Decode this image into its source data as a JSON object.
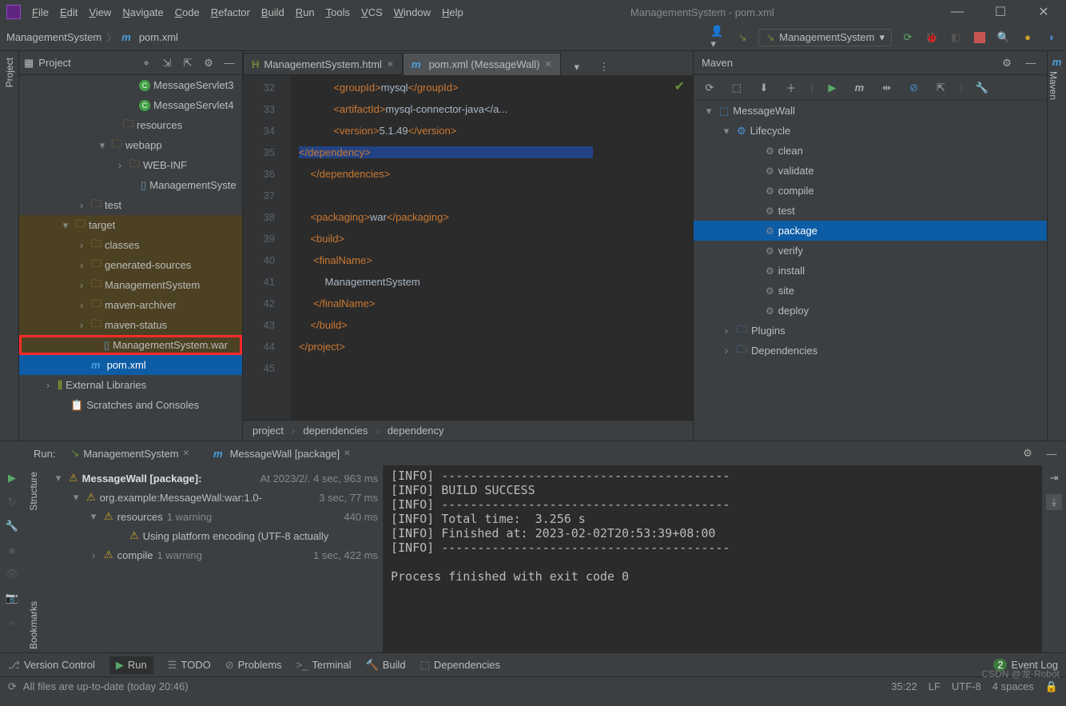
{
  "title": "ManagementSystem - pom.xml",
  "menu": [
    "File",
    "Edit",
    "View",
    "Navigate",
    "Code",
    "Refactor",
    "Build",
    "Run",
    "Tools",
    "VCS",
    "Window",
    "Help"
  ],
  "breadcrumb": {
    "root": "ManagementSystem",
    "file": "pom.xml"
  },
  "config_selected": "ManagementSystem",
  "project_panel": {
    "title": "Project",
    "tree": [
      {
        "indent": 120,
        "chev": "",
        "icon": "class",
        "label": "MessageServlet3"
      },
      {
        "indent": 120,
        "chev": "",
        "icon": "class",
        "label": "MessageServlet4"
      },
      {
        "indent": 100,
        "chev": "",
        "icon": "folder",
        "label": "resources"
      },
      {
        "indent": 86,
        "chev": "▾",
        "icon": "folder",
        "label": "webapp"
      },
      {
        "indent": 108,
        "chev": "›",
        "icon": "folder",
        "label": "WEB-INF"
      },
      {
        "indent": 122,
        "chev": "",
        "icon": "file",
        "label": "ManagementSyste"
      },
      {
        "indent": 60,
        "chev": "›",
        "icon": "folder",
        "label": "test"
      },
      {
        "indent": 40,
        "chev": "▾",
        "icon": "folder-o",
        "label": "target",
        "hl": true
      },
      {
        "indent": 60,
        "chev": "›",
        "icon": "folder-o",
        "label": "classes",
        "hl": true
      },
      {
        "indent": 60,
        "chev": "›",
        "icon": "folder-o",
        "label": "generated-sources",
        "hl": true
      },
      {
        "indent": 60,
        "chev": "›",
        "icon": "folder-o",
        "label": "ManagementSystem",
        "hl": true
      },
      {
        "indent": 60,
        "chev": "›",
        "icon": "folder-o",
        "label": "maven-archiver",
        "hl": true
      },
      {
        "indent": 60,
        "chev": "›",
        "icon": "folder-o",
        "label": "maven-status",
        "hl": true
      },
      {
        "indent": 76,
        "chev": "",
        "icon": "file",
        "label": "ManagementSystem.war",
        "hl": true,
        "redbox": true
      },
      {
        "indent": 60,
        "chev": "",
        "icon": "file-m",
        "label": "pom.xml",
        "sel": true
      },
      {
        "indent": 18,
        "chev": "›",
        "icon": "lib",
        "label": "External Libraries"
      },
      {
        "indent": 34,
        "chev": "",
        "icon": "scratch",
        "label": "Scratches and Consoles"
      }
    ]
  },
  "tabs": [
    {
      "icon": "H",
      "label": "ManagementSystem.html",
      "active": false
    },
    {
      "icon": "m",
      "label": "pom.xml (MessageWall)",
      "active": true
    }
  ],
  "gutter_start": 32,
  "code_lines": [
    "            <groupId>mysql</groupId>",
    "            <artifactId>mysql-connector-java</a...",
    "            <version>5.1.49</version>",
    "        </dependency>",
    "    </dependencies>",
    "",
    "    <packaging>war</packaging>",
    "    <build>",
    "     <finalName>",
    "         ManagementSystem",
    "     </finalName>",
    "    </build>",
    "</project>",
    ""
  ],
  "editor_crumbs": [
    "project",
    "dependencies",
    "dependency"
  ],
  "maven": {
    "title": "Maven",
    "root": "MessageWall",
    "lifecycle_label": "Lifecycle",
    "lifecycle": [
      "clean",
      "validate",
      "compile",
      "test",
      "package",
      "verify",
      "install",
      "site",
      "deploy"
    ],
    "selected": "package",
    "extra": [
      "Plugins",
      "Dependencies"
    ]
  },
  "run": {
    "header": "Run:",
    "tabs": [
      {
        "label": "ManagementSystem"
      },
      {
        "label": "MessageWall [package]"
      }
    ],
    "tree": [
      {
        "indent": 0,
        "chev": "▾",
        "icon": "warn",
        "strong": "MessageWall [package]:",
        "meta": "At 2023/2/. 4 sec, 963 ms"
      },
      {
        "indent": 22,
        "chev": "▾",
        "icon": "warn",
        "strong": "",
        "label": "org.example:MessageWall:war:1.0-",
        "meta": "3 sec, 77 ms"
      },
      {
        "indent": 44,
        "chev": "▾",
        "icon": "warn",
        "strong": "",
        "label": "resources",
        "note": "1 warning",
        "meta": "440 ms"
      },
      {
        "indent": 76,
        "chev": "",
        "icon": "warn",
        "strong": "",
        "label": "Using platform encoding (UTF-8 actually"
      },
      {
        "indent": 44,
        "chev": "›",
        "icon": "warn",
        "strong": "",
        "label": "compile",
        "note": "1 warning",
        "meta": "1 sec, 422 ms"
      }
    ],
    "output": [
      "[INFO] ----------------------------------------",
      "[INFO] BUILD SUCCESS",
      "[INFO] ----------------------------------------",
      "[INFO] Total time:  3.256 s",
      "[INFO] Finished at: 2023-02-02T20:53:39+08:00",
      "[INFO] ----------------------------------------",
      "",
      "Process finished with exit code 0"
    ]
  },
  "bottom": [
    {
      "icon": "⎇",
      "label": "Version Control"
    },
    {
      "icon": "▶",
      "label": "Run",
      "active": true
    },
    {
      "icon": "☰",
      "label": "TODO"
    },
    {
      "icon": "⊘",
      "label": "Problems"
    },
    {
      "icon": ">_",
      "label": "Terminal"
    },
    {
      "icon": "🔨",
      "label": "Build"
    },
    {
      "icon": "⬚",
      "label": "Dependencies"
    }
  ],
  "event_log": {
    "count": "2",
    "label": "Event Log"
  },
  "status": {
    "left": "All files are up-to-date (today 20:46)",
    "pos": "35:22",
    "lf": "LF",
    "enc": "UTF-8",
    "indent": "4 spaces"
  },
  "watermark": "CSDN @龙·Robot",
  "rail_left": "Project",
  "rail_left2": "Structure",
  "rail_left3": "Bookmarks",
  "rail_right": "Maven"
}
